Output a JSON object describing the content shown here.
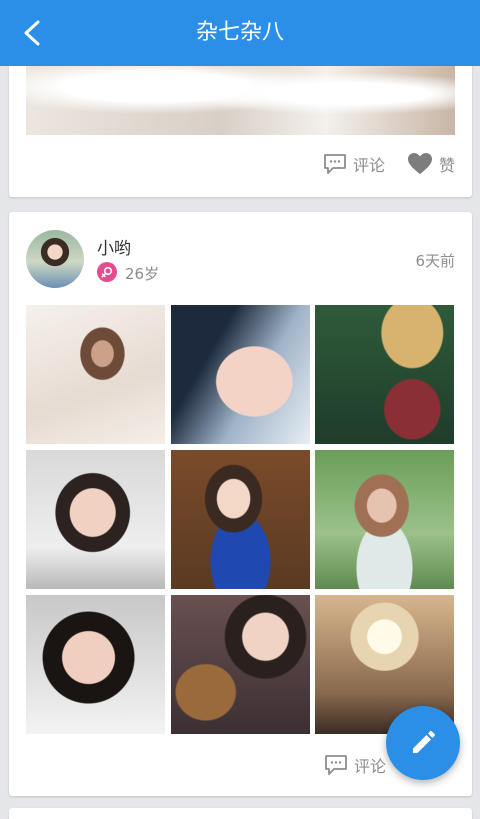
{
  "header": {
    "title": "杂七杂八"
  },
  "cards": [
    {
      "actions": {
        "comment_label": "评论",
        "like_label": "赞"
      }
    },
    {
      "user": {
        "name": "小哟",
        "age": "26岁"
      },
      "timestamp": "6天前",
      "photos": [
        "photo-1",
        "photo-2",
        "photo-3",
        "photo-4",
        "photo-5",
        "photo-6",
        "photo-7",
        "photo-8",
        "photo-9"
      ],
      "actions": {
        "comment_label": "评论"
      }
    }
  ],
  "colors": {
    "accent": "#2b8fe8",
    "gender_badge": "#e84a8f"
  },
  "icons": {
    "back": "chevron-left-icon",
    "comment": "comment-icon",
    "like": "heart-icon",
    "fab": "pencil-icon",
    "gender": "female-icon"
  }
}
